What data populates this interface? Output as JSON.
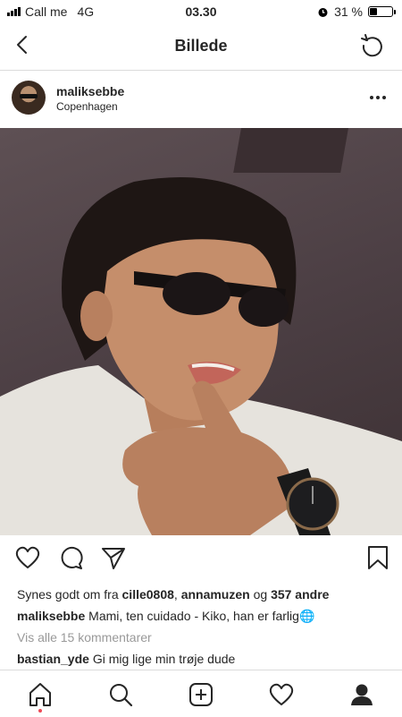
{
  "status": {
    "carrier": "Call me",
    "network": "4G",
    "time": "03.30",
    "battery": "31 %",
    "battery_level": 0.31
  },
  "nav": {
    "title": "Billede"
  },
  "post": {
    "username": "maliksebbe",
    "location": "Copenhagen",
    "likes": {
      "prefix": "Synes godt om fra ",
      "user1": "cille0808",
      "sep": ", ",
      "user2": "annamuzen",
      "og": " og ",
      "others": "357 andre"
    },
    "caption": {
      "user": "maliksebbe",
      "text": " Mami, ten cuidado - Kiko, han er farlig",
      "emoji": "🌐"
    },
    "view_all": "Vis alle 15 kommentarer",
    "comment": {
      "user": "bastian_yde",
      "text": " Gi mig lige min trøje dude"
    }
  },
  "colors": {
    "notification_dot": "#ed4956",
    "muted_text": "#999999"
  }
}
